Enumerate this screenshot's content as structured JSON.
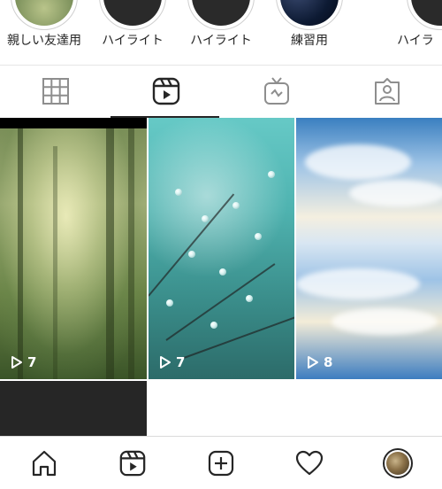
{
  "highlights": [
    {
      "label": "親しい友達用",
      "thumb_color": "#7a8f5a"
    },
    {
      "label": "ハイライト",
      "thumb_color": "#2a2a2a"
    },
    {
      "label": "ハイライト",
      "thumb_color": "#2a2a2a"
    },
    {
      "label": "練習用",
      "thumb_color": "#0d1a33"
    },
    {
      "label": "ハイラ",
      "thumb_color": "#2a2a2a"
    }
  ],
  "tabs": [
    {
      "icon": "grid-icon",
      "selected": false
    },
    {
      "icon": "reels-icon",
      "selected": true
    },
    {
      "icon": "igtv-icon",
      "selected": false
    },
    {
      "icon": "tagged-icon",
      "selected": false
    }
  ],
  "grid": {
    "tiles": [
      {
        "subject": "misty-forest",
        "play_count": "7"
      },
      {
        "subject": "dewdrops",
        "play_count": "7"
      },
      {
        "subject": "sky-reflection",
        "play_count": "8"
      }
    ]
  },
  "bottom_nav": [
    "home-icon",
    "reels-icon",
    "create-icon",
    "activity-icon",
    "profile-avatar"
  ],
  "colors": {
    "text": "#262626",
    "divider": "#dbdbdb",
    "background": "#ffffff"
  }
}
